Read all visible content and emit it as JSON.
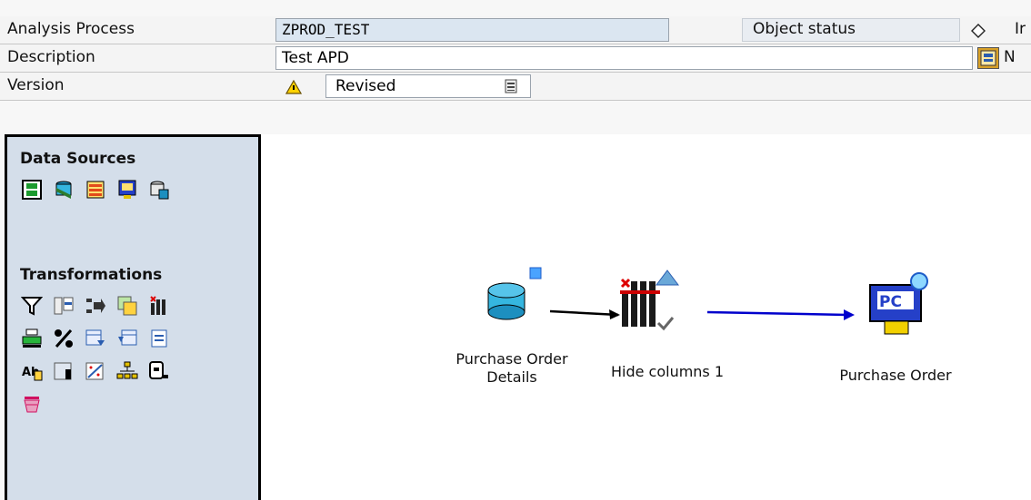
{
  "header": {
    "analysis_process_label": "Analysis Process",
    "analysis_process_value": "ZPROD_TEST",
    "object_status_label": "Object status",
    "object_status_value_partial": "Ir",
    "description_label": "Description",
    "description_value": "Test APD",
    "description_trailing_partial": "N",
    "version_label": "Version",
    "version_value": "Revised"
  },
  "palette": {
    "data_sources_title": "Data Sources",
    "data_sources_icons": [
      "infoprovider-icon",
      "database-table-icon",
      "flat-file-icon",
      "pc-query-icon",
      "cube-icon"
    ],
    "transformations_title": "Transformations",
    "transformations_icons": [
      "filter-icon",
      "join-icon",
      "transform-arrow-icon",
      "copy-icon",
      "hide-columns-icon",
      "sort-icon",
      "percent-icon",
      "list-transform-icon",
      "smooth-icon",
      "table-icon",
      "abc-icon",
      "bar-table-icon",
      "scatter-icon",
      "hierarchy-icon",
      "routine-icon",
      "basket-icon"
    ]
  },
  "canvas": {
    "nodes": [
      {
        "label_line1": "Purchase Order",
        "label_line2": "Details",
        "icon": "database-table-icon"
      },
      {
        "label_line1": "Hide columns 1",
        "label_line2": "",
        "icon": "hide-columns-icon"
      },
      {
        "label_line1": "Purchase Order",
        "label_line2": "",
        "icon": "pc-query-icon"
      }
    ]
  },
  "colors": {
    "panel_bg": "#d4deea",
    "field_highlight": "#dbe6f1",
    "arrow_blue": "#0000cc",
    "arrow_black": "#000000"
  }
}
